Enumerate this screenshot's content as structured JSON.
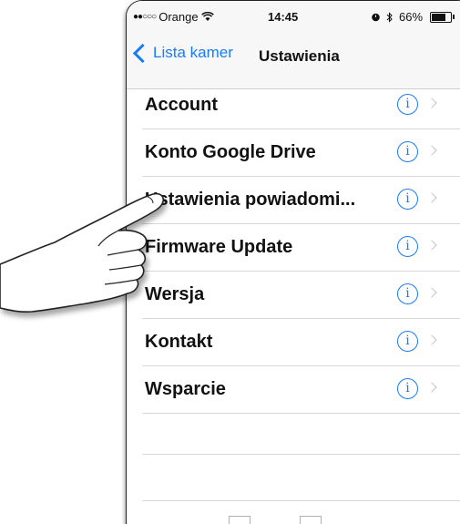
{
  "status_bar": {
    "carrier": "Orange",
    "time": "14:45",
    "battery": "66%",
    "icons": [
      "signal-dots-icon",
      "wifi-icon",
      "alarm-icon",
      "bluetooth-icon",
      "battery-icon"
    ]
  },
  "nav": {
    "back_label": "Lista kamer",
    "title": "Ustawienia"
  },
  "settings": {
    "items": [
      {
        "label": "Account"
      },
      {
        "label": "Konto Google Drive"
      },
      {
        "label": "Ustawienia powiadomi..."
      },
      {
        "label": "Firmware Update"
      },
      {
        "label": "Wersja"
      },
      {
        "label": "Kontakt"
      },
      {
        "label": "Wsparcie"
      }
    ]
  },
  "colors": {
    "accent": "#1a7cf5",
    "separator": "#d8d8d8",
    "nav_background": "#f7f7f7"
  }
}
